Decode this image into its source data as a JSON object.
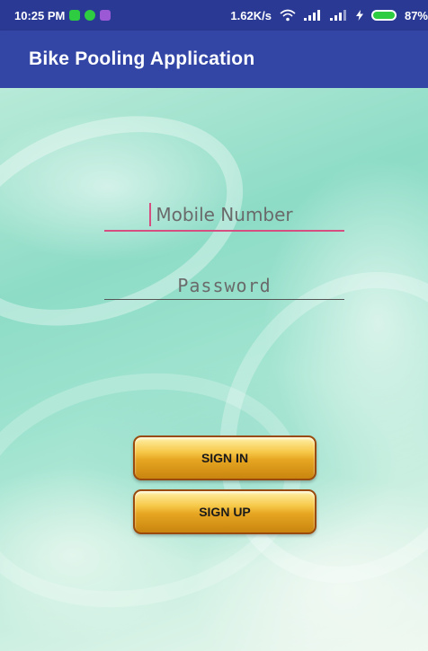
{
  "status_bar": {
    "time": "10:25 PM",
    "network_speed": "1.62K/s",
    "battery_percent": "87%",
    "icons": [
      "notification-icon",
      "whatsapp-icon",
      "message-icon",
      "wifi-icon",
      "signal-icon",
      "signal-icon",
      "charging-icon",
      "battery-icon"
    ]
  },
  "app_bar": {
    "title": "Bike Pooling Application"
  },
  "form": {
    "mobile_placeholder": "Mobile Number",
    "password_placeholder": "Password"
  },
  "buttons": {
    "sign_in": "SIGN IN",
    "sign_up": "SIGN UP"
  },
  "colors": {
    "app_bar": "#3346a6",
    "status_bar": "#2a3a94",
    "focus_underline": "#d64d7f",
    "button_gold": "#e6a521",
    "button_border": "#9a4a0c"
  }
}
